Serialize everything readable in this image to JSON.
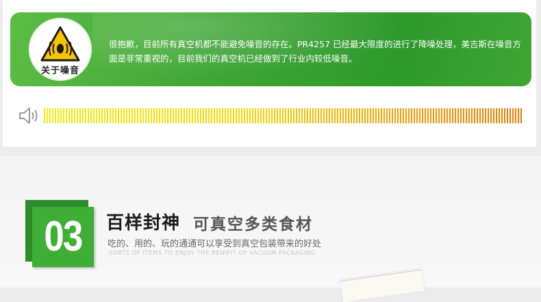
{
  "noise_section": {
    "badge_label": "关于噪音",
    "message": "很抱歉，目前所有真空机都不能避免噪音的存在。PR4257 已经最大限度的进行了降噪处理，美吉斯在噪音方面是非常重视的，目前我们的真空机已经做到了行业内较低噪音。",
    "volume_level": 1.0,
    "colors": {
      "banner_green": "#3fa536",
      "bar_start": "#f2ee10",
      "bar_end": "#f07a00"
    },
    "icons": [
      "warning-triangle-icon",
      "speaker-icon"
    ]
  },
  "feature_section": {
    "number": "03",
    "title_main": "百样封神",
    "title_sub": "可真空多类食材",
    "description": "吃的、用的、玩的通通可以享受到真空包装带来的好处",
    "description_en": "SORTS OF ITEMS TO ENJOY THE BENIFIT OF VACUUM PACKAGING",
    "colors": {
      "badge_green": "#3fae36",
      "badge_dark": "#2e8c2a"
    }
  }
}
